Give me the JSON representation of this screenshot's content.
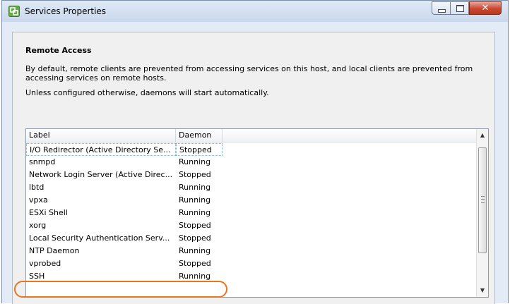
{
  "window": {
    "title": "Services Properties"
  },
  "section": {
    "title": "Remote Access",
    "description": "By default, remote clients are prevented from accessing services on this host, and local clients are prevented from accessing services on remote hosts.",
    "note": "Unless configured otherwise, daemons will start automatically."
  },
  "table": {
    "columns": [
      "Label",
      "Daemon"
    ],
    "rows": [
      {
        "label": "I/O Redirector (Active Directory Se...",
        "daemon": "Stopped"
      },
      {
        "label": "snmpd",
        "daemon": "Running"
      },
      {
        "label": "Network Login Server (Active Direc...",
        "daemon": "Stopped"
      },
      {
        "label": "lbtd",
        "daemon": "Running"
      },
      {
        "label": "vpxa",
        "daemon": "Running"
      },
      {
        "label": "ESXi Shell",
        "daemon": "Running"
      },
      {
        "label": "xorg",
        "daemon": "Stopped"
      },
      {
        "label": "Local Security Authentication Serv...",
        "daemon": "Stopped"
      },
      {
        "label": "NTP Daemon",
        "daemon": "Running"
      },
      {
        "label": "vprobed",
        "daemon": "Stopped"
      },
      {
        "label": "SSH",
        "daemon": "Running"
      }
    ]
  },
  "icons": {
    "app": "vsphere-app-icon",
    "minimize": "minimize-icon",
    "maximize": "maximize-icon",
    "close": "close-icon",
    "scroll_up": "scroll-up-arrow-icon",
    "scroll_down": "scroll-down-arrow-icon"
  },
  "colors": {
    "highlight": "#e8761e",
    "close_button": "#c7472f"
  }
}
